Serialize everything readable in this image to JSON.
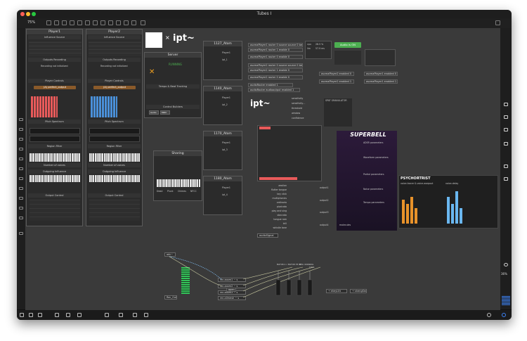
{
  "window": {
    "title": "Tubes I"
  },
  "toolbar": {
    "zoom": "75%"
  },
  "sidebar_right": {
    "zoom_percent": "36%"
  },
  "player1": {
    "title": "Player1",
    "sections": [
      "Influence Source",
      "Outputs Recording",
      "Player Controls",
      "Pitch Spectrum",
      "Region Filter",
      "Number of voices",
      "Outgoing Influence",
      "Output Control"
    ],
    "recording_status": "Recording not initialized",
    "file": "(A) perfect_output"
  },
  "player2": {
    "title": "Player2",
    "sections": [
      "Influence Source",
      "Outputs Recording",
      "Player Controls",
      "Pitch Spectrum",
      "Region Filter",
      "Number of voices",
      "Outgoing Influence",
      "Output Control"
    ],
    "recording_status": "Recording not initialized",
    "file": "(A) perfect_output"
  },
  "server": {
    "title": "Server",
    "logo_x": "×",
    "logo_text": "ipt~",
    "status": "RUNNING",
    "section_tempo": "Tempo & Beat Tracking",
    "section_control": "Control Builders",
    "buttons": [
      "Audio",
      "MIDI"
    ]
  },
  "sharing": {
    "title": "Sharing",
    "instruments": [
      "Dead",
      "Pluck",
      "Chimes",
      "NFCC"
    ]
  },
  "atom1": {
    "title": "1127_Atom",
    "player": "Player1",
    "description": "ipt_1"
  },
  "atom2": {
    "title": "1140_Atom",
    "player": "Player1",
    "description": "ipt_2"
  },
  "atom3": {
    "title": "1170_Atom",
    "player": "Player1",
    "description": "ipt_3"
  },
  "atom4": {
    "title": "1180_Atom",
    "player": "Player1",
    "description": "ipt_4"
  },
  "messages": [
    "oscmaPlayer1 router 0 source source 0 beep",
    "oscmaPlayer1 router 1 enable 0",
    "oscmaPlayer1 router 0 enable 0",
    "oscmaPlayer2 router 0 source source 0 beep",
    "oscmaPlayer2 router 1 enable 0",
    "oscmaPlayer2 router 0 enable 0",
    "audioRouter enabled 1",
    "audioRouter audiooutput enabled 1"
  ],
  "status_block": {
    "audio_on": "Audio is ON",
    "cpu_label": "cpu",
    "cpu_value": "28.5 %",
    "latency_label": "lim",
    "latency_value": "57.9 ms",
    "rows": [
      "ipt_1",
      "ipt_2",
      "ipt_3"
    ]
  },
  "right_msgs": [
    "oscmaPlayer1 enabled 0",
    "oscmaPlayer2 enabled 0",
    "oscmaPlayer1 enabled 1",
    "oscmaPlayer2 enabled 1"
  ],
  "ipt_panel": {
    "logo": "ipt~",
    "params": [
      "sensitivity",
      "sensitivity…",
      "threshold",
      "window",
      "confidence"
    ],
    "values": [
      "1.3",
      "0.04",
      "-80",
      "60",
      "5"
    ]
  },
  "bars_list": {
    "labels": [
      "tremolo",
      "flutter",
      "mute",
      "pizz",
      "ord",
      "harm",
      "col legno",
      "slap",
      "gliss",
      "stacc",
      "sul pont",
      "sul tasto",
      "tongue ram",
      "whistle tone"
    ],
    "values": [
      "20.8%",
      "3.5%",
      "1.5%",
      "3.2%",
      "2.3%",
      "1.2%",
      "0.6%",
      "0.4%",
      "1.7%",
      "0.6%",
      "0.8%",
      "0.3%",
      "0.1%",
      "49.3%"
    ]
  },
  "nodes": {
    "labels": [
      "aeolian",
      "flutter tongue",
      "key click",
      "multiphonics",
      "ordinario",
      "pizzicato",
      "play and sing",
      "staccato",
      "tongue ram",
      "trill",
      "whistle tone"
    ],
    "outputs": [
      "output1",
      "output2",
      "output3",
      "output4"
    ],
    "bottom_msg": "audioSignal"
  },
  "granulator": {
    "title": "SPAT GRANULATOR",
    "tabs": [
      "chorus",
      "delay",
      "lowpass",
      "reverb"
    ]
  },
  "superbell": {
    "title": "SUPERBELL",
    "sec1": "ADSR parameters",
    "sec2": "Waveform parameters",
    "sec3": "Partial parameters",
    "sec4": "Noise parameters",
    "sec5": "Tempo parameters",
    "footer": "molecules"
  },
  "psych": {
    "title": "PSYCHORTRIST",
    "left_label": "voice-tracer & voice-warpout",
    "right_label": "voice-delay"
  },
  "patch": {
    "objs": [
      "s rdel",
      "rec.zoom1 ~ s",
      "rec.zoom2 ~ s",
      "rec.zoom3 ~ s",
      "rec.allmesh ~ s",
      "Rec_Out",
      "open",
      "open"
    ],
    "right_hdr": [
      "BAT48.1 c",
      "BAT48.78 M",
      "DPA 4090",
      "AKG C411"
    ],
    "outs": [
      "→ ekeyLitt",
      "→ shengZe",
      "→ shengSeaVex"
    ],
    "top_obj": "adc~"
  }
}
